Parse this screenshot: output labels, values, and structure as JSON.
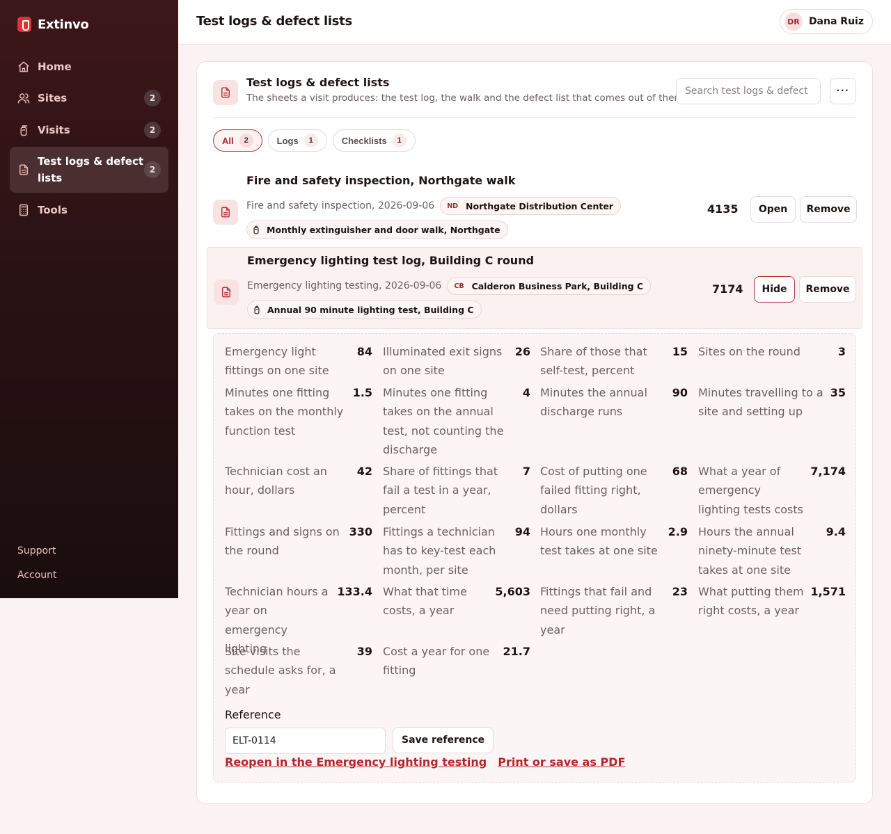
{
  "app": {
    "name": "Extinvo"
  },
  "sidebar": {
    "items": [
      {
        "label": "Home",
        "icon": "home-icon",
        "badge": ""
      },
      {
        "label": "Sites",
        "icon": "users-icon",
        "badge": "2"
      },
      {
        "label": "Visits",
        "icon": "extinguisher-icon",
        "badge": "2"
      },
      {
        "label": "Test logs & defect lists",
        "icon": "document-icon",
        "badge": "2",
        "active": true
      },
      {
        "label": "Tools",
        "icon": "calculator-icon",
        "badge": ""
      }
    ],
    "footer": {
      "support": "Support",
      "account": "Account"
    }
  },
  "topbar": {
    "title": "Test logs & defect lists"
  },
  "user": {
    "initials": "DR",
    "name": "Dana Ruiz"
  },
  "card": {
    "title": "Test logs & defect lists",
    "subtitle": "The sheets a visit produces: the test log, the walk and the defect list that comes out of them.",
    "search_placeholder": "Search test logs & defect",
    "more_label": "···"
  },
  "filters": [
    {
      "label": "All",
      "count": "2",
      "active": true
    },
    {
      "label": "Logs",
      "count": "1"
    },
    {
      "label": "Checklists",
      "count": "1"
    }
  ],
  "rows": [
    {
      "title": "Fire and safety inspection, Northgate walk",
      "meta": "Fire and safety inspection, 2026-09-06",
      "site_abbr": "ND",
      "site": "Northgate Distribution Center",
      "visit": "Monthly extinguisher and door walk, Northgate",
      "number": "4135",
      "primary_action": "Open",
      "remove_action": "Remove"
    },
    {
      "title": "Emergency lighting test log, Building C round",
      "meta": "Emergency lighting testing, 2026-09-06",
      "site_abbr": "CB",
      "site": "Calderon Business Park, Building C",
      "visit": "Annual 90 minute lighting test, Building C",
      "number": "7174",
      "primary_action": "Hide",
      "remove_action": "Remove"
    }
  ],
  "metrics": [
    {
      "label": "Emergency light fittings on one site",
      "value": "84"
    },
    {
      "label": "Illuminated exit signs on one site",
      "value": "26"
    },
    {
      "label": "Share of those that self-test, percent",
      "value": "15"
    },
    {
      "label": "Sites on the round",
      "value": "3"
    },
    {
      "label": "Minutes one fitting takes on the monthly function test",
      "value": "1.5"
    },
    {
      "label": "Minutes one fitting takes on the annual test, not counting the discharge",
      "value": "4"
    },
    {
      "label": "Minutes the annual discharge runs",
      "value": "90"
    },
    {
      "label": "Minutes travelling to a site and setting up",
      "value": "35"
    },
    {
      "label": "Technician cost an hour, dollars",
      "value": "42"
    },
    {
      "label": "Share of fittings that fail a test in a year, percent",
      "value": "7"
    },
    {
      "label": "Cost of putting one failed fitting right, dollars",
      "value": "68"
    },
    {
      "label": "What a year of emergency lighting tests costs",
      "value": "7,174"
    },
    {
      "label": "Fittings and signs on the round",
      "value": "330"
    },
    {
      "label": "Fittings a technician has to key-test each month, per site",
      "value": "94"
    },
    {
      "label": "Hours one monthly test takes at one site",
      "value": "2.9"
    },
    {
      "label": "Hours the annual ninety-minute test takes at one site",
      "value": "9.4"
    },
    {
      "label": "Technician hours a year on emergency lighting",
      "value": "133.4"
    },
    {
      "label": "What that time costs, a year",
      "value": "5,603"
    },
    {
      "label": "Fittings that fail and need putting right, a year",
      "value": "23"
    },
    {
      "label": "What putting them right costs, a year",
      "value": "1,571"
    },
    {
      "label": "Site visits the schedule asks for, a year",
      "value": "39"
    },
    {
      "label": "Cost a year for one fitting",
      "value": "21.7"
    }
  ],
  "reference": {
    "label": "Reference",
    "value": "ELT-0114",
    "save_label": "Save reference",
    "reopen_link": "Reopen in the Emergency lighting testing",
    "print_link": "Print or save as PDF"
  },
  "colors": {
    "accent": "#b5353b",
    "sidebar": "#2a1214",
    "link": "#b3262c"
  }
}
